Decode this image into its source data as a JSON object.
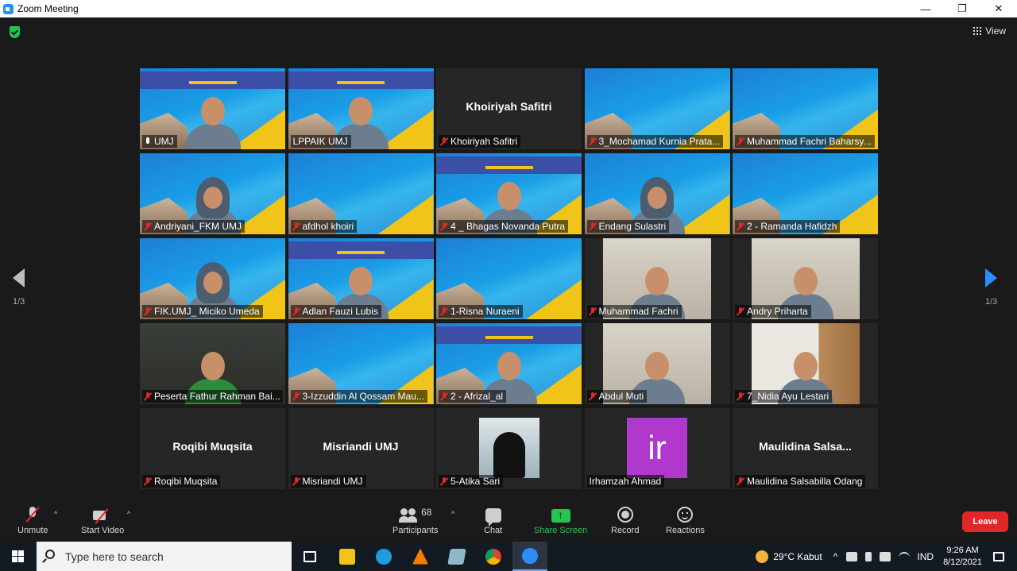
{
  "window": {
    "title": "Zoom Meeting",
    "controls": [
      "—",
      "❐",
      "✕"
    ]
  },
  "header": {
    "view_label": "View"
  },
  "pagination": {
    "left": "1/3",
    "right": "1/3"
  },
  "tiles": [
    {
      "label": "UMJ",
      "type": "slide-person",
      "active": true,
      "mic": "on"
    },
    {
      "label": "LPPAIK UMJ",
      "type": "slide-person",
      "mic": "none"
    },
    {
      "label": "Khoiriyah Safitri",
      "type": "name",
      "mic": "off"
    },
    {
      "label": "3_Mochamad Kurnia Prata...",
      "type": "slide",
      "mic": "off"
    },
    {
      "label": "Muhammad Fachri Baharsy...",
      "type": "slide",
      "mic": "off"
    },
    {
      "label": "Andriyani_FKM UMJ",
      "type": "slide-hijab",
      "mic": "off"
    },
    {
      "label": "afdhol khoiri",
      "type": "slide",
      "mic": "off"
    },
    {
      "label": "4 _ Bhagas Novanda Putra",
      "type": "slide-person",
      "mic": "off"
    },
    {
      "label": "Endang Sulastri",
      "type": "slide-hijab",
      "mic": "off"
    },
    {
      "label": "2 - Ramanda Hafidzh",
      "type": "slide",
      "mic": "off"
    },
    {
      "label": "FIK.UMJ_ Miciko Umeda",
      "type": "slide-hijab",
      "mic": "off"
    },
    {
      "label": "Adlan Fauzi Lubis",
      "type": "slide-person",
      "mic": "off"
    },
    {
      "label": "1-Risna Nuraeni",
      "type": "slide",
      "mic": "off"
    },
    {
      "label": "Muhammad Fachri",
      "type": "room",
      "mic": "off"
    },
    {
      "label": "Andry Priharta",
      "type": "room",
      "mic": "off"
    },
    {
      "label": "Peserta Fathur Rahman Bai...",
      "type": "dark",
      "mic": "off"
    },
    {
      "label": "3-Izzuddin Al Qossam Mau...",
      "type": "slide",
      "mic": "off"
    },
    {
      "label": "2 - Afrizal_al",
      "type": "slide-person",
      "mic": "off"
    },
    {
      "label": "Abdul Muti",
      "type": "room",
      "mic": "off"
    },
    {
      "label": "7_Nidia Ayu Lestari",
      "type": "room-wood",
      "mic": "off"
    },
    {
      "label": "Roqibi Muqsita",
      "type": "name",
      "mic": "off"
    },
    {
      "label": "Misriandi UMJ",
      "type": "name",
      "mic": "off"
    },
    {
      "label": "5-Atika Sari",
      "type": "photo",
      "mic": "off"
    },
    {
      "label": "Irhamzah Ahmad",
      "type": "initials",
      "initials": "ir",
      "mic": "none"
    },
    {
      "label": "Maulidina Salsabilla Odang",
      "type": "name",
      "display_name": "Maulidina  Salsa...",
      "mic": "off"
    }
  ],
  "toolbar": {
    "unmute": "Unmute",
    "start_video": "Start Video",
    "participants": "Participants",
    "participants_count": "68",
    "chat": "Chat",
    "share_screen": "Share Screen",
    "record": "Record",
    "reactions": "Reactions",
    "leave": "Leave"
  },
  "taskbar": {
    "search_placeholder": "Type here to search",
    "weather": "29°C  Kabut",
    "language": "IND",
    "time": "9:26 AM",
    "date": "8/12/2021"
  },
  "colors": {
    "accent": "#2d8cff",
    "share": "#23c552",
    "leave": "#e02828",
    "active_border": "#c8d64a"
  }
}
